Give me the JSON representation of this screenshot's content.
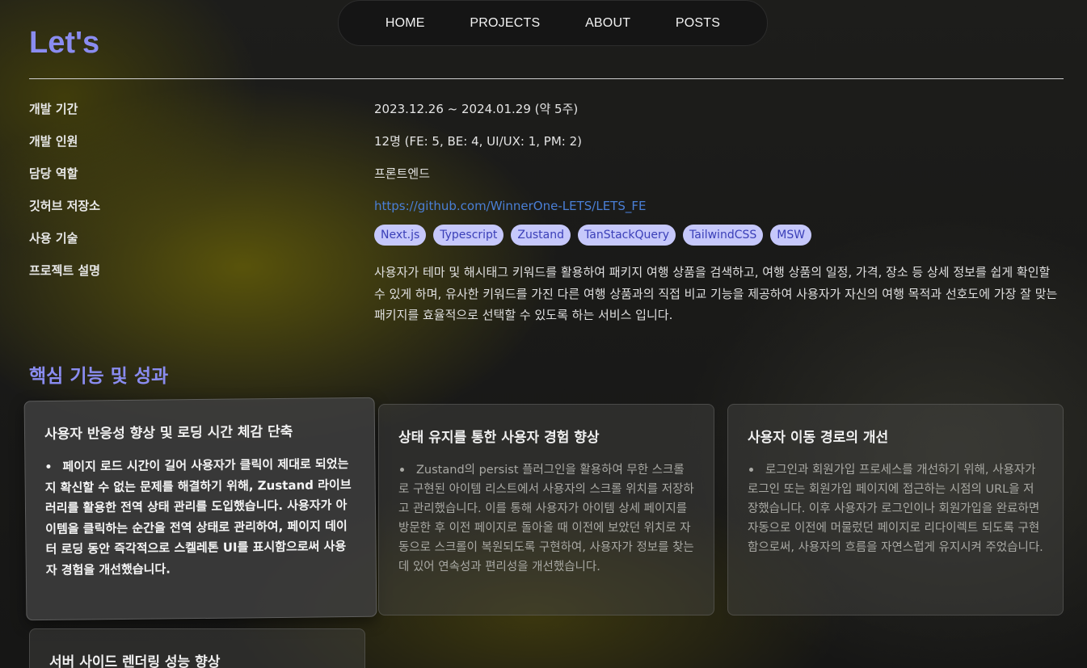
{
  "nav": {
    "items": [
      "HOME",
      "PROJECTS",
      "ABOUT",
      "POSTS"
    ]
  },
  "project": {
    "title": "Let's",
    "rows": {
      "period": {
        "label": "개발 기간",
        "value": "2023.12.26 ~ 2024.01.29 (약 5주)"
      },
      "team": {
        "label": "개발 인원",
        "value": "12명 (FE: 5, BE: 4, UI/UX: 1, PM: 2)"
      },
      "role": {
        "label": "담당 역할",
        "value": "프론트엔드"
      },
      "repo": {
        "label": "깃허브 저장소",
        "value": "https://github.com/WinnerOne-LETS/LETS_FE"
      },
      "stack": {
        "label": "사용 기술",
        "tags": [
          "Next.js",
          "Typescript",
          "Zustand",
          "TanStackQuery",
          "TailwindCSS",
          "MSW"
        ]
      },
      "desc": {
        "label": "프로젝트 설명",
        "value": "사용자가 테마 및 해시태그 키워드를 활용하여 패키지 여행 상품을 검색하고, 여행 상품의 일정, 가격, 장소 등 상세 정보를 쉽게 확인할 수 있게 하며, 유사한 키워드를 가진 다른 여행 상품과의 직접 비교 기능을 제공하여 사용자가 자신의 여행 목적과 선호도에 가장 잘 맞는 패키지를 효율적으로 선택할 수 있도록 하는 서비스 입니다."
      }
    }
  },
  "features": {
    "title": "핵심 기능 및 성과",
    "cards": [
      {
        "title": "사용자 반응성 향상 및 로딩 시간 체감 단축",
        "body": "페이지 로드 시간이 길어 사용자가 클릭이 제대로 되었는지 확신할 수 없는 문제를 해결하기 위해, Zustand 라이브러리를 활용한 전역 상태 관리를 도입했습니다. 사용자가 아이템을 클릭하는 순간을 전역 상태로 관리하여, 페이지 데이터 로딩 동안 즉각적으로 스켈레톤 UI를 표시함으로써 사용자 경험을 개선했습니다."
      },
      {
        "title": "상태 유지를 통한 사용자 경험 향상",
        "body": "Zustand의 persist 플러그인을 활용하여 무한 스크롤로 구현된 아이템 리스트에서 사용자의 스크롤 위치를 저장하고 관리했습니다. 이를 통해 사용자가 아이템 상세 페이지를 방문한 후 이전 페이지로 돌아올 때 이전에 보았던 위치로 자동으로 스크롤이 복원되도록 구현하여, 사용자가 정보를 찾는데 있어 연속성과 편리성을 개선했습니다."
      },
      {
        "title": "사용자 이동 경로의 개선",
        "body": "로그인과 회원가입 프로세스를 개선하기 위해, 사용자가 로그인 또는 회원가입 페이지에 접근하는 시점의 URL을 저장했습니다. 이후 사용자가 로그인이나 회원가입을 완료하면 자동으로 이전에 머물렀던 페이지로 리다이렉트 되도록 구현함으로써, 사용자의 흐름을 자연스럽게 유지시켜 주었습니다."
      },
      {
        "title": "서버 사이드 렌더링 성능 향상"
      }
    ]
  }
}
